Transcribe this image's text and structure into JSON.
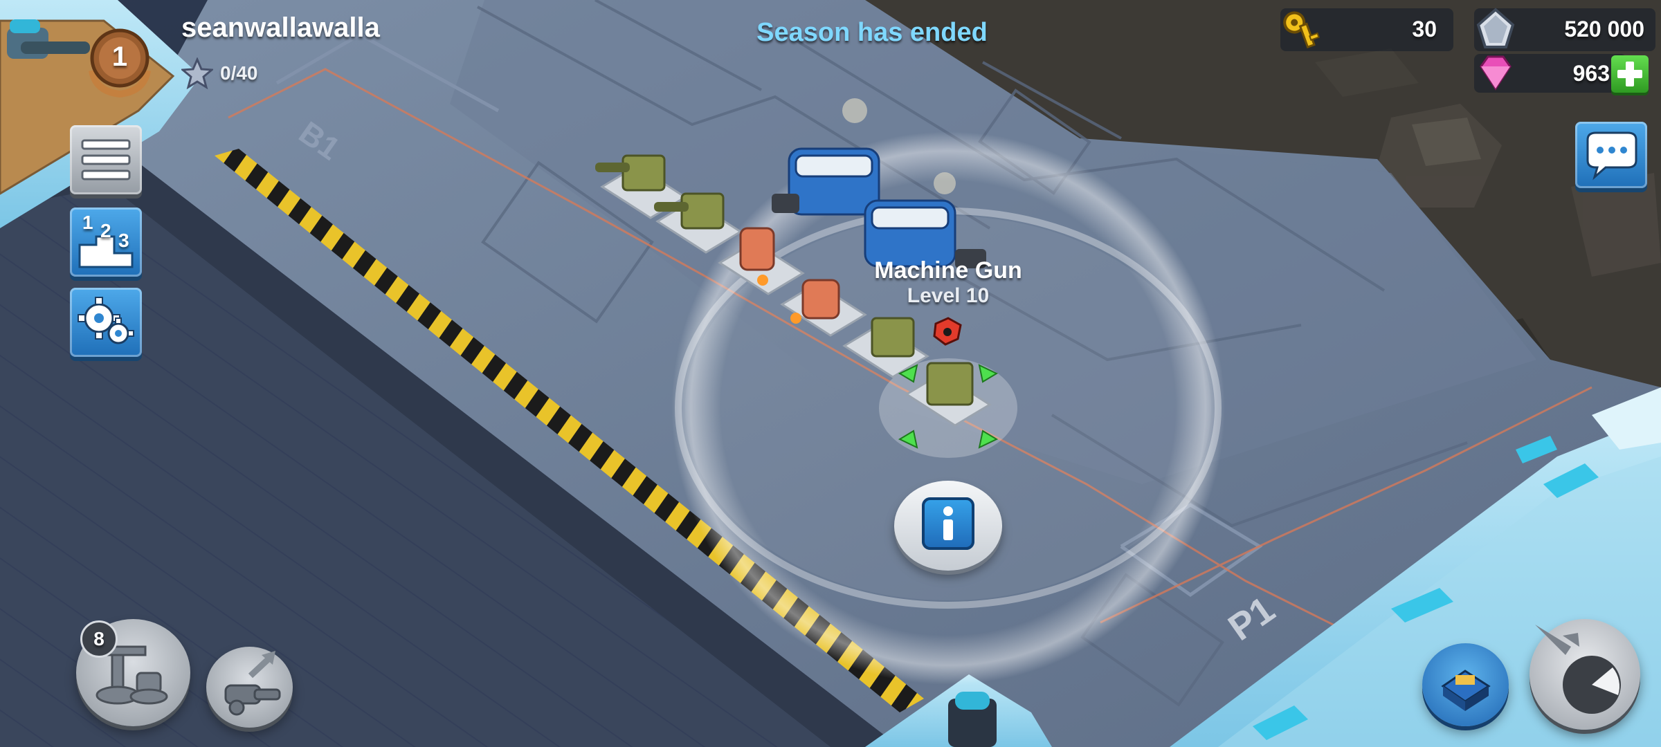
{
  "player": {
    "name": "seanwallawalla",
    "rank": "1",
    "stars": "0/40"
  },
  "season": {
    "status": "Season has ended"
  },
  "resources": {
    "keys": "30",
    "iron": "520 000",
    "diamonds": "963"
  },
  "selection": {
    "building_name": "Machine Gun",
    "building_level": "Level 10"
  },
  "map_labels": {
    "left_pad": "B1",
    "right_pad": "P1"
  },
  "ranking_button": {
    "glyph_1": "1",
    "glyph_2": "2",
    "glyph_3": "3"
  },
  "build_menu": {
    "count": "8"
  },
  "colors": {
    "season_text": "#7fd8ff",
    "key_gold": "#f2c11b",
    "diamond_pink": "#e94eb8",
    "plus_green": "#3ac22c",
    "menu_blue": "#2f86d0"
  },
  "icons": {
    "menu": "hamburger-icon",
    "ranking": "podium-icon",
    "settings": "gear-icon",
    "chat": "chat-bubble-icon",
    "info": "info-icon",
    "build": "construction-icon",
    "upgrade": "cannon-upgrade-icon",
    "hq": "headquarters-icon",
    "attack": "radar-attack-icon"
  }
}
